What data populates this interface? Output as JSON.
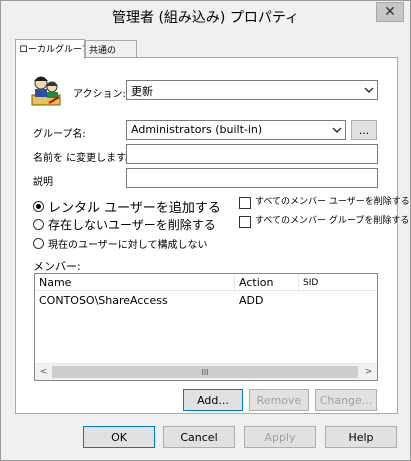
{
  "window": {
    "title": "管理者 (組み込み) プロパティ"
  },
  "tabs": [
    {
      "label": "ローカルグループ"
    },
    {
      "label": "共通の"
    }
  ],
  "form": {
    "action_label": "アクション:",
    "action_value": "更新",
    "group_name_label": "グループ名:",
    "group_name_value": "Administrators (built-in)",
    "browse_label": "...",
    "rename_label": "名前を に変更します。",
    "rename_value": "",
    "description_label": "説明",
    "description_value": ""
  },
  "options": {
    "radio_add": "レンタル ユーザーを追加する",
    "radio_remove": "存在しないユーザーを削除する",
    "radio_configure": "現在のユーザーに対して構成しない",
    "check_delete_users": "すべてのメンバー ユーザーを削除する",
    "check_delete_groups": "すべてのメンバー グループを削除する"
  },
  "members": {
    "label": "メンバー:",
    "columns": [
      "Name",
      "Action",
      "SID"
    ],
    "rows": [
      {
        "name": "CONTOSO\\ShareAccess",
        "action": "ADD",
        "sid": ""
      }
    ],
    "scroll_left": "<",
    "scroll_right": ">",
    "scroll_thumb": "III"
  },
  "member_buttons": {
    "add": "Add...",
    "remove": "Remove",
    "change": "Change..."
  },
  "dialog_buttons": {
    "ok": "OK",
    "cancel": "Cancel",
    "apply": "Apply",
    "help": "Help"
  },
  "close_glyph": "✕"
}
